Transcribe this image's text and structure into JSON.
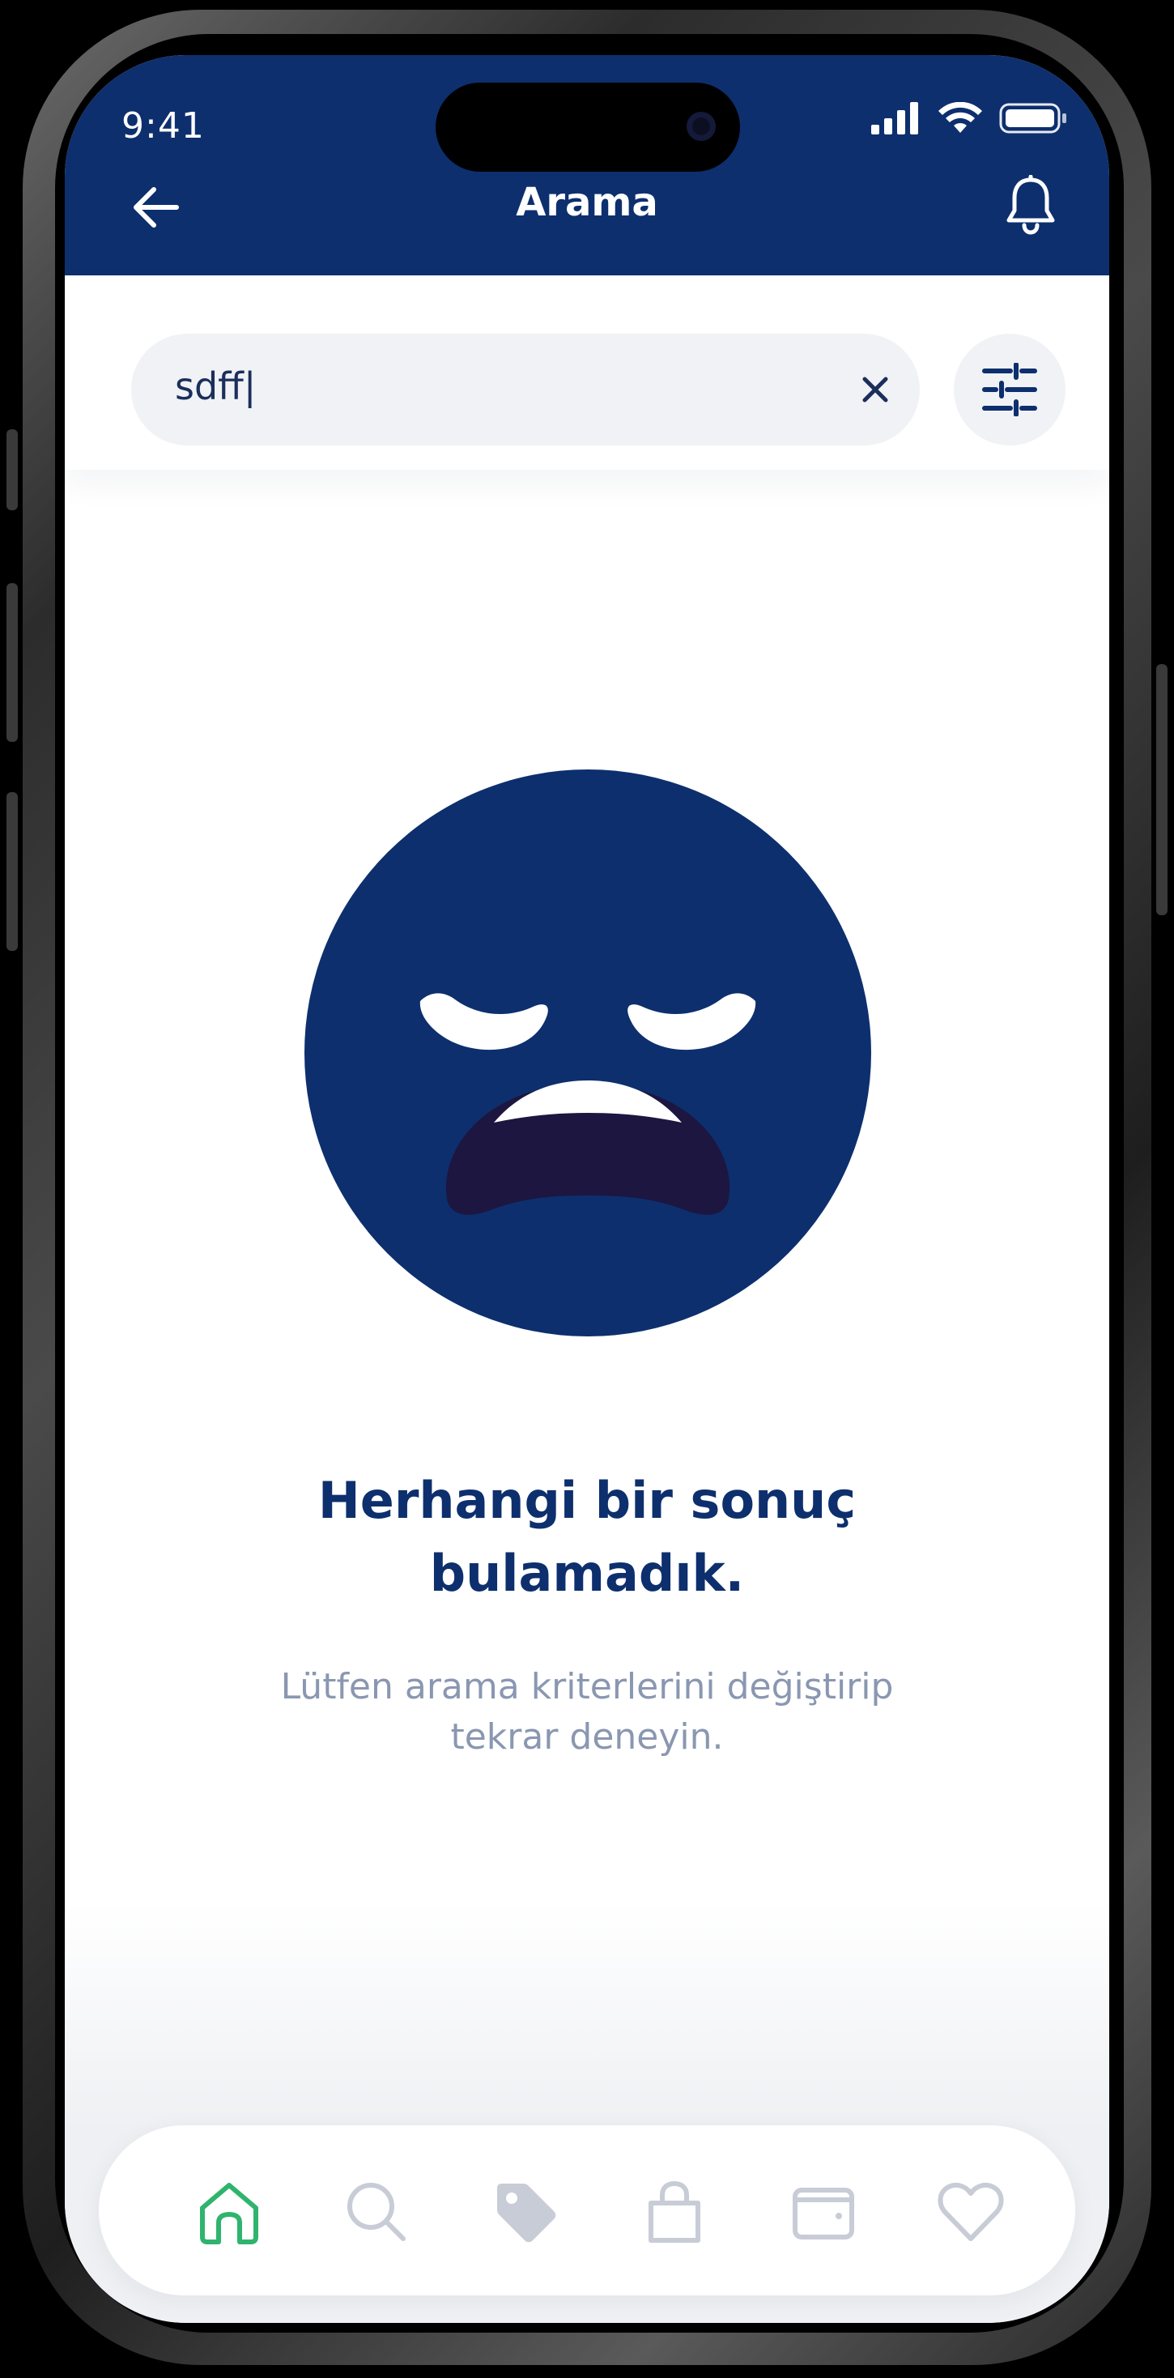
{
  "status_bar": {
    "time": "9:41"
  },
  "header": {
    "title": "Arama"
  },
  "search": {
    "value": "sdff",
    "caret": "|"
  },
  "empty_state": {
    "headline_line1": "Herhangi bir sonuç",
    "headline_line2": "bulamadık.",
    "subtext_line1": "Lütfen arama kriterlerini değiştirip",
    "subtext_line2": "tekrar deneyin."
  },
  "colors": {
    "primary": "#0d2f6e",
    "active_nav": "#2fb46e",
    "inactive_nav": "#c7ccd6",
    "background": "#ffffff"
  },
  "bottom_nav": {
    "items": [
      {
        "icon": "home-icon",
        "active": true
      },
      {
        "icon": "search-icon",
        "active": false
      },
      {
        "icon": "tag-icon",
        "active": false
      },
      {
        "icon": "bag-icon",
        "active": false
      },
      {
        "icon": "wallet-icon",
        "active": false
      },
      {
        "icon": "heart-icon",
        "active": false
      }
    ]
  }
}
